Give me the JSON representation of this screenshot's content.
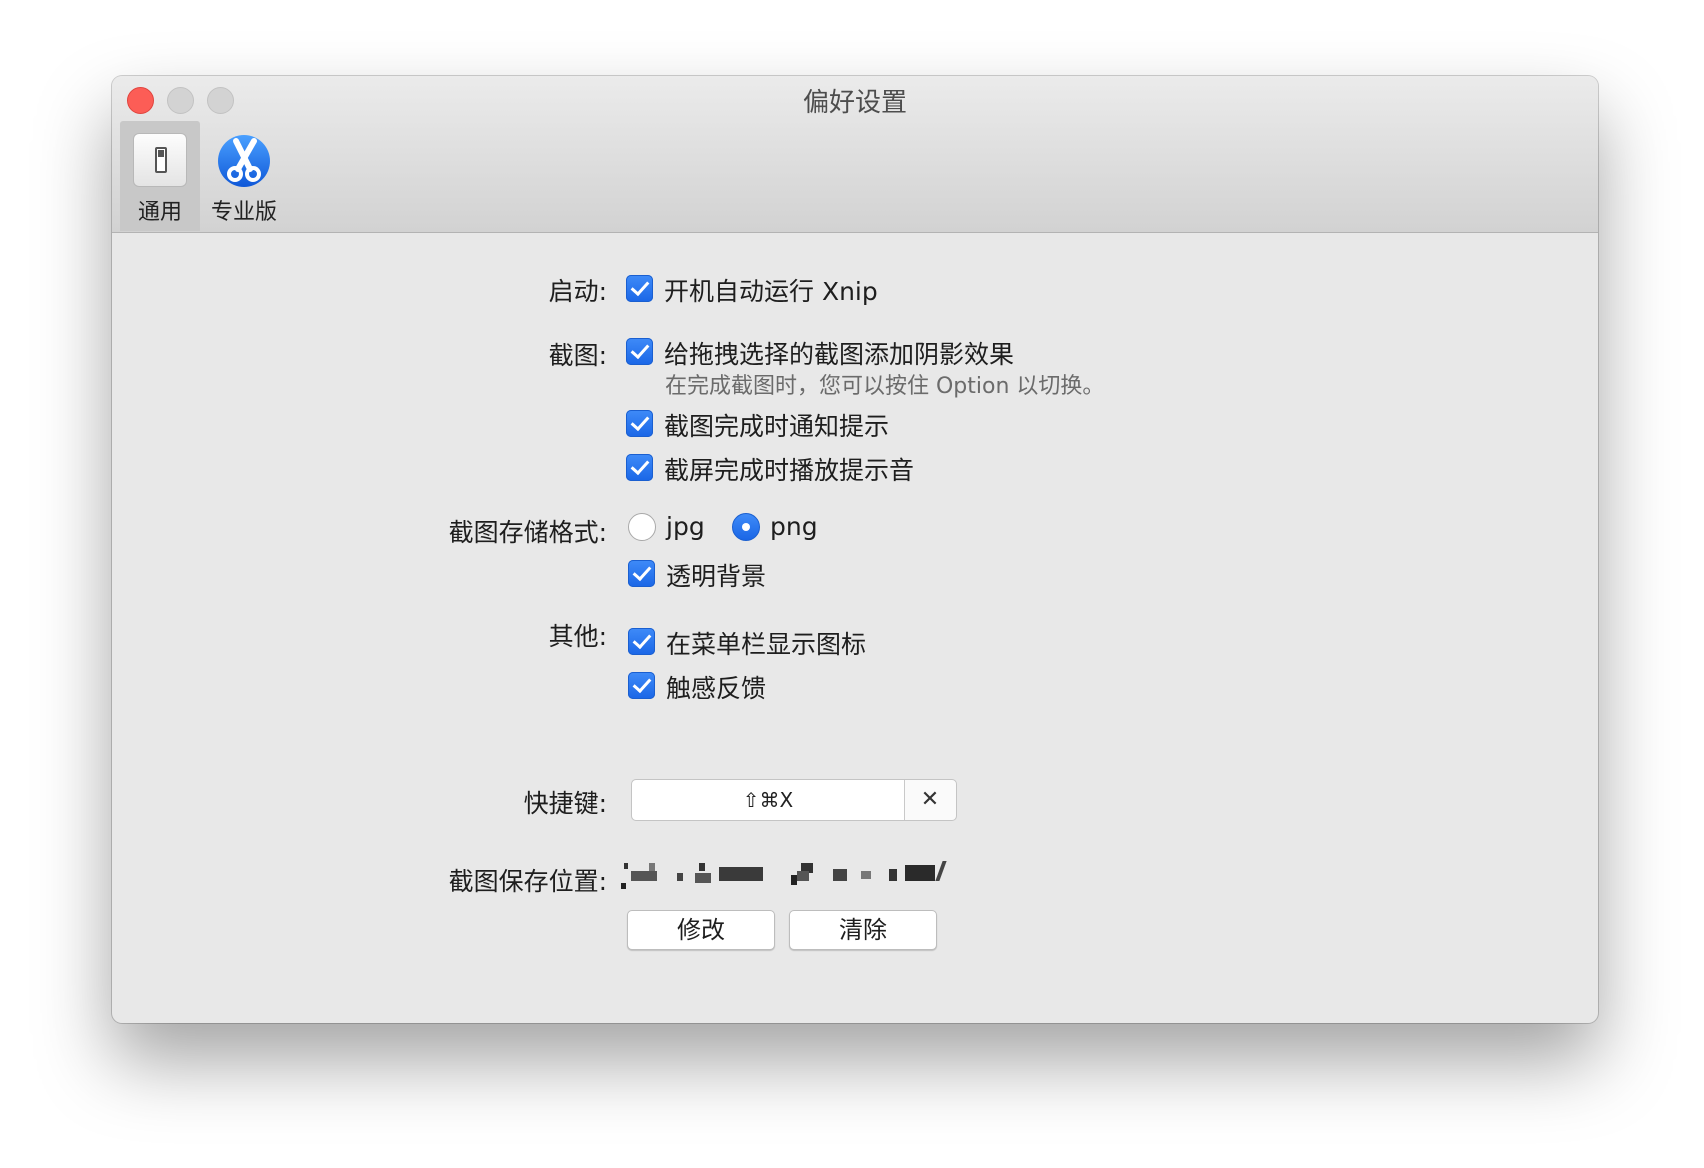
{
  "window": {
    "title": "偏好设置"
  },
  "toolbar": {
    "items": [
      {
        "label": "通用",
        "icon": "switch-icon",
        "selected": true
      },
      {
        "label": "专业版",
        "icon": "scissors-icon",
        "selected": false
      }
    ]
  },
  "settings": {
    "startup": {
      "label": "启动:",
      "options": [
        {
          "label": "开机自动运行 Xnip",
          "checked": true
        }
      ]
    },
    "screenshot": {
      "label": "截图:",
      "options": [
        {
          "label": "给拖拽选择的截图添加阴影效果",
          "checked": true,
          "hint": "在完成截图时，您可以按住 Option 以切换。"
        },
        {
          "label": "截图完成时通知提示",
          "checked": true
        },
        {
          "label": "截屏完成时播放提示音",
          "checked": true
        }
      ]
    },
    "format": {
      "label": "截图存储格式:",
      "radios": [
        {
          "label": "jpg",
          "selected": false
        },
        {
          "label": "png",
          "selected": true
        }
      ],
      "options": [
        {
          "label": "透明背景",
          "checked": true
        }
      ]
    },
    "other": {
      "label": "其他:",
      "options": [
        {
          "label": "在菜单栏显示图标",
          "checked": true
        },
        {
          "label": "触感反馈",
          "checked": true
        }
      ]
    },
    "shortcut": {
      "label": "快捷键:",
      "value": "⇧⌘X",
      "clear_symbol": "✕"
    },
    "save_location": {
      "label": "截图保存位置:",
      "buttons": {
        "modify": "修改",
        "clear": "清除"
      }
    }
  },
  "colors": {
    "accent": "#1f6ff0",
    "close": "#fc5d56"
  }
}
